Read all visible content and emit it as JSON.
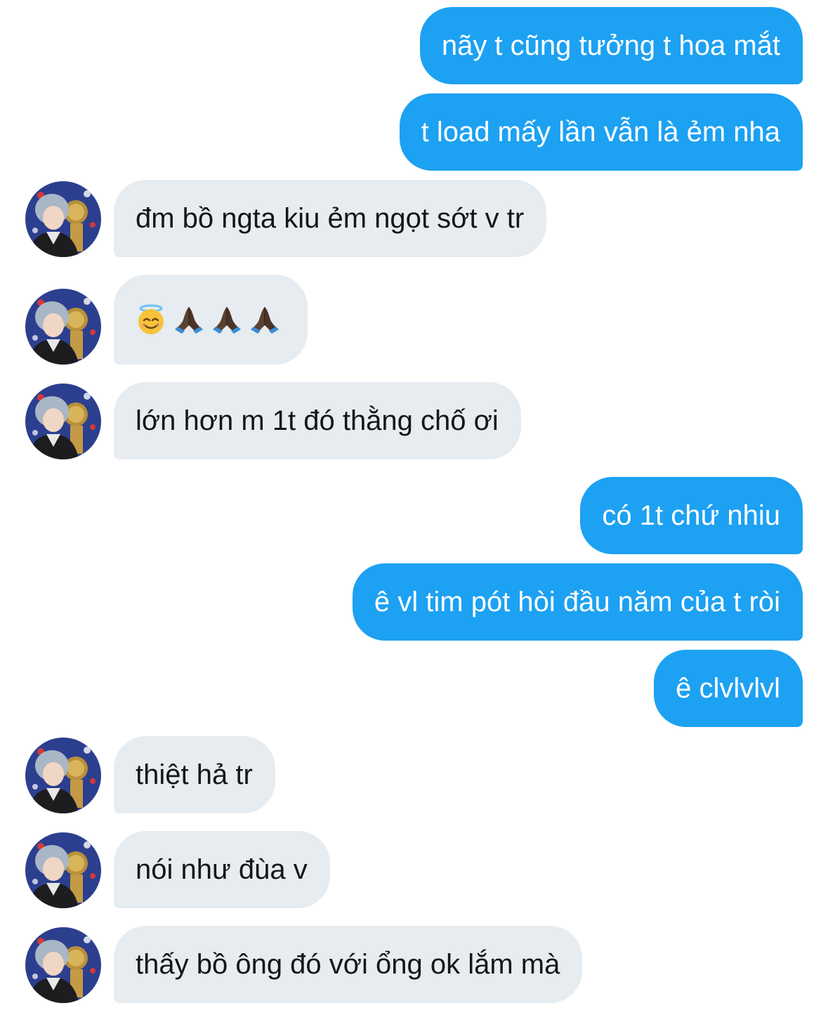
{
  "colors": {
    "sent_bubble": "#1da1f2",
    "sent_text": "#ffffff",
    "received_bubble": "#e6ecf0",
    "received_text": "#14171a",
    "background": "#ffffff"
  },
  "messages": [
    {
      "direction": "sent",
      "text": "nãy t cũng tưởng t hoa mắt"
    },
    {
      "direction": "sent",
      "text": "t load mấy lần vẫn là ẻm nha"
    },
    {
      "direction": "received",
      "text": "đm bồ ngta kiu ẻm ngọt sớt v tr",
      "avatar_icon": "user-avatar-icon"
    },
    {
      "direction": "received",
      "emoji": [
        "smiling-face-with-halo-icon",
        "folded-hands-icon",
        "folded-hands-icon",
        "folded-hands-icon"
      ],
      "avatar_icon": "user-avatar-icon"
    },
    {
      "direction": "received",
      "text": "lớn hơn m 1t đó thằng chố ơi",
      "avatar_icon": "user-avatar-icon"
    },
    {
      "direction": "sent",
      "text": "có 1t chứ nhiu"
    },
    {
      "direction": "sent",
      "text": "ê vl tim pót hòi đầu năm của t ròi"
    },
    {
      "direction": "sent",
      "text": "ê clvlvlvl"
    },
    {
      "direction": "received",
      "text": "thiệt hả tr",
      "avatar_icon": "user-avatar-icon"
    },
    {
      "direction": "received",
      "text": "nói như đùa v",
      "avatar_icon": "user-avatar-icon"
    },
    {
      "direction": "received",
      "text": "thấy bồ ông đó với ổng ok lắm mà",
      "avatar_icon": "user-avatar-icon"
    }
  ]
}
